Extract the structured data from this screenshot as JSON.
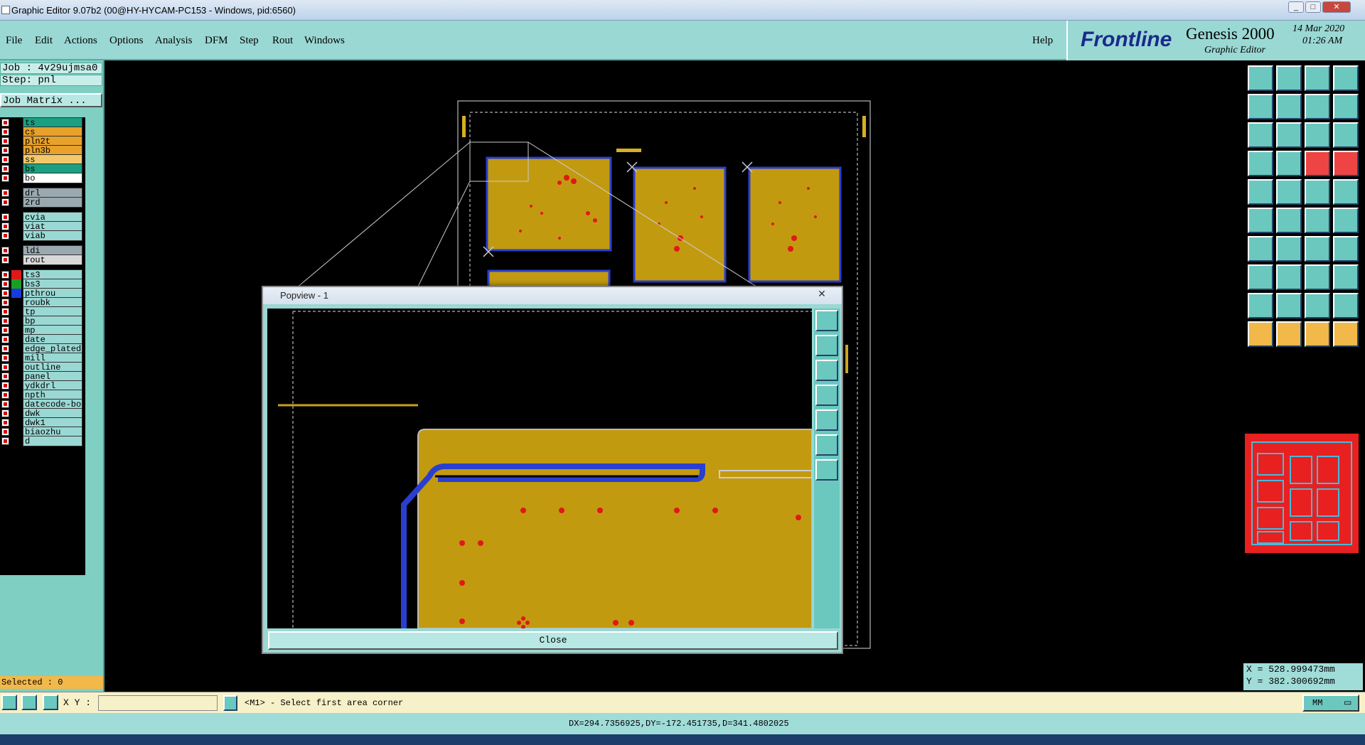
{
  "window": {
    "title": "Graphic Editor 9.07b2 (00@HY-HYCAM-PC153 - Windows, pid:6560)"
  },
  "menu": {
    "items": [
      "File",
      "Edit",
      "Actions",
      "Options",
      "Analysis",
      "DFM",
      "Step",
      "Rout",
      "Windows"
    ],
    "help": "Help"
  },
  "logo": {
    "brand": "Frontline",
    "product": "Genesis 2000",
    "subtitle": "Graphic Editor",
    "date": "14 Mar 2020",
    "time": "01:26 AM"
  },
  "job": {
    "job": "Job : 4v29ujmsa0",
    "step": "Step: pnl",
    "matrix_button": "Job Matrix ..."
  },
  "layers": [
    {
      "name": "ts",
      "color": "#1aa080"
    },
    {
      "name": "cs",
      "color": "#e8a12a"
    },
    {
      "name": "pln2t",
      "color": "#e8a12a"
    },
    {
      "name": "pln3b",
      "color": "#e8a12a"
    },
    {
      "name": "ss",
      "color": "#f2c86a"
    },
    {
      "name": "bs",
      "color": "#1aa080"
    },
    {
      "name": "bo",
      "color": "#ffffff"
    },
    {
      "name": "drl",
      "color": "#9aa9b0"
    },
    {
      "name": "2rd",
      "color": "#9aa9b0"
    },
    {
      "name": "cvia",
      "color": "#9ad8d4"
    },
    {
      "name": "viat",
      "color": "#9ad8d4"
    },
    {
      "name": "viab",
      "color": "#9ad8d4"
    },
    {
      "name": "ldi",
      "color": "#9aa9b0"
    },
    {
      "name": "rout",
      "color": "#d8d8d8"
    },
    {
      "name": "ts3",
      "color": "#9ad8d4"
    },
    {
      "name": "bs3",
      "color": "#9ad8d4"
    },
    {
      "name": "pthrou",
      "color": "#9ad8d4"
    },
    {
      "name": "roubk",
      "color": "#9ad8d4"
    },
    {
      "name": "tp",
      "color": "#9ad8d4"
    },
    {
      "name": "bp",
      "color": "#9ad8d4"
    },
    {
      "name": "mp",
      "color": "#9ad8d4"
    },
    {
      "name": "date",
      "color": "#9ad8d4"
    },
    {
      "name": "edge_plated",
      "color": "#9ad8d4"
    },
    {
      "name": "mill",
      "color": "#9ad8d4"
    },
    {
      "name": "outline",
      "color": "#9ad8d4"
    },
    {
      "name": "panel",
      "color": "#9ad8d4"
    },
    {
      "name": "ydkdrl",
      "color": "#9ad8d4"
    },
    {
      "name": "npth",
      "color": "#9ad8d4"
    },
    {
      "name": "datecode-bo",
      "color": "#9ad8d4"
    },
    {
      "name": "dwk",
      "color": "#9ad8d4"
    },
    {
      "name": "dwk1",
      "color": "#9ad8d4"
    },
    {
      "name": "biaozhu",
      "color": "#9ad8d4"
    },
    {
      "name": "d",
      "color": "#9ad8d4"
    }
  ],
  "selected": "Selected : 0",
  "popup": {
    "title": "Popview - 1",
    "close_label": "Close"
  },
  "coords": {
    "x": "X =  528.999473mm",
    "y": "Y =  382.300692mm"
  },
  "status": {
    "xy_label": "X Y :",
    "xy_value": "",
    "prompt": "<M1> - Select first area corner",
    "units": "MM"
  },
  "measure": "DX=294.7356925,DY=-172.451735,D=341.4802025"
}
